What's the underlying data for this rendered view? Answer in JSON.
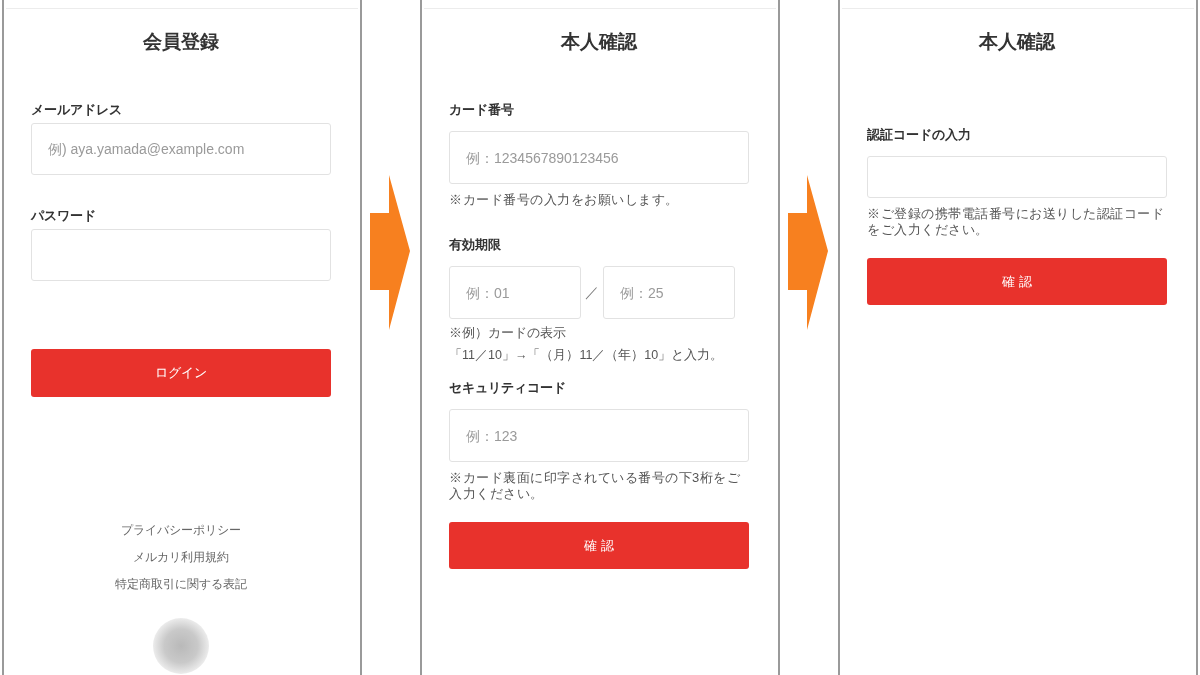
{
  "screens": [
    {
      "title": "会員登録",
      "fields": [
        {
          "kind": "text",
          "label": "メールアドレス",
          "placeholder": "例) aya.yamada@example.com"
        },
        {
          "kind": "password",
          "label": "パスワード"
        }
      ],
      "button": "ログイン",
      "footer_links": [
        "プライバシーポリシー",
        "メルカリ利用規約",
        "特定商取引に関する表記"
      ]
    },
    {
      "title": "本人確認",
      "fields": [
        {
          "kind": "text",
          "label": "カード番号",
          "placeholder": "例：1234567890123456",
          "notes": [
            "※カード番号の入力をお願いします。"
          ]
        },
        {
          "kind": "expiry",
          "label": "有効期限",
          "placeholders": [
            "例：01",
            "例：25"
          ],
          "separator": "／",
          "notes": [
            "※例）カードの表示",
            "「11／10」→「（月）11／（年）10」と入力。"
          ]
        },
        {
          "kind": "text",
          "label": "セキュリティコード",
          "placeholder": "例：123",
          "notes": [
            "※カード裏面に印字されている番号の下3桁をご入力ください。"
          ]
        }
      ],
      "button": "確 認"
    },
    {
      "title": "本人確認",
      "fields": [
        {
          "kind": "text",
          "label": "認証コードの入力",
          "notes": [
            "※ご登録の携帯電話番号にお送りした認証コードをご入力ください。"
          ]
        }
      ],
      "button": "確 認"
    }
  ]
}
